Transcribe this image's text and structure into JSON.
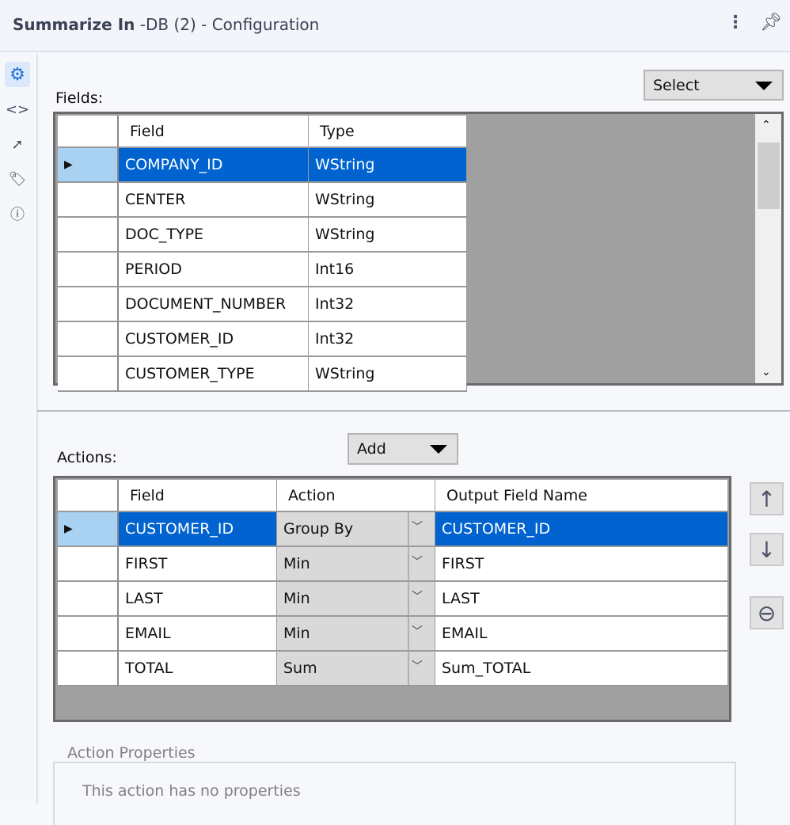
{
  "header": {
    "title_bold": "Summarize In",
    "title_rest": " -DB (2) - Configuration"
  },
  "rail": [
    "gear-icon",
    "code-icon",
    "arrow-circle-icon",
    "tag-icon",
    "help-icon"
  ],
  "fields": {
    "label": "Fields:",
    "select_label": "Select",
    "columns": [
      "Field",
      "Type"
    ],
    "rows": [
      [
        "COMPANY_ID",
        "WString"
      ],
      [
        "CENTER",
        "WString"
      ],
      [
        "DOC_TYPE",
        "WString"
      ],
      [
        "PERIOD",
        "Int16"
      ],
      [
        "DOCUMENT_NUMBER",
        "Int32"
      ],
      [
        "CUSTOMER_ID",
        "Int32"
      ],
      [
        "CUSTOMER_TYPE",
        "WString"
      ]
    ]
  },
  "actions": {
    "label": "Actions:",
    "add_label": "Add",
    "columns": [
      "Field",
      "Action",
      "Output Field Name"
    ],
    "rows": [
      [
        "CUSTOMER_ID",
        "Group By",
        "CUSTOMER_ID"
      ],
      [
        "FIRST",
        "Min",
        "FIRST"
      ],
      [
        "LAST",
        "Min",
        "LAST"
      ],
      [
        "EMAIL",
        "Min",
        "EMAIL"
      ],
      [
        "TOTAL",
        "Sum",
        "Sum_TOTAL"
      ]
    ]
  },
  "properties": {
    "legend": "Action Properties",
    "text": "This action has no properties"
  },
  "colors": {
    "selection": "#0063cf",
    "row_header_current": "#a9d1f2"
  }
}
